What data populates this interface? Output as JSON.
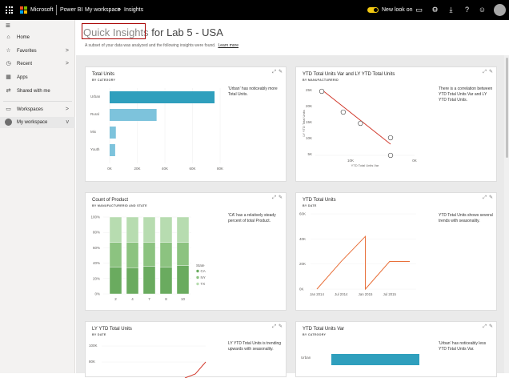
{
  "topbar": {
    "ms_label": "Microsoft",
    "app_label": "Power BI",
    "breadcrumb": [
      "My workspace",
      "Insights"
    ],
    "breadcrumb_sep": ">",
    "new_look_label": "New look on",
    "icons": [
      "comment-icon",
      "settings-icon",
      "download-icon",
      "help-icon",
      "smiley-icon"
    ]
  },
  "sidebar": {
    "items": [
      {
        "label": "Home",
        "icon": "home-icon",
        "chevron": ""
      },
      {
        "label": "Favorites",
        "icon": "star-icon",
        "chevron": ">"
      },
      {
        "label": "Recent",
        "icon": "clock-icon",
        "chevron": ">"
      },
      {
        "label": "Apps",
        "icon": "apps-icon",
        "chevron": ""
      },
      {
        "label": "Shared with me",
        "icon": "share-icon",
        "chevron": ""
      },
      {
        "label": "Workspaces",
        "icon": "workspaces-icon",
        "chevron": ">"
      },
      {
        "label": "My workspace",
        "icon": "workspace-avatar-icon",
        "chevron": "v"
      }
    ]
  },
  "header": {
    "title_highlight": "Quick Insights",
    "title_rest": "for Lab 5 - USA",
    "subtitle": "A subset of your data was analyzed and the following insights were found.",
    "learn_more": "Learn more"
  },
  "colors": {
    "bar_dark": "#2f9fbd",
    "bar_light": "#7dc3dc",
    "green_dark": "#6aab5f",
    "green_mid": "#8cc380",
    "green_light": "#b7dcb0",
    "line_orange": "#e8703a",
    "scatter_line": "#d23b2e"
  },
  "cards": [
    {
      "title": "Total Units",
      "subtitle": "BY CATEGORY",
      "description": "'Urban' has noticeably more Total Units.",
      "chart_data": {
        "type": "bar",
        "orientation": "horizontal",
        "categories": [
          "Urban",
          "Rural",
          "Mix",
          "Youth"
        ],
        "values": [
          76000,
          34000,
          4500,
          4000
        ],
        "highlight": "Urban",
        "xlim": [
          0,
          80000
        ],
        "xticks": [
          "0K",
          "20K",
          "40K",
          "60K",
          "80K"
        ]
      }
    },
    {
      "title": "YTD Total Units Var and LY YTD Total Units",
      "subtitle": "BY MANUFACTURERID",
      "description": "There is a correlation between YTD Total Units Var and LY YTD Total Units.",
      "chart_data": {
        "type": "scatter",
        "xlabel": "YTD Total Units Var",
        "ylabel": "LY YTD Total Units",
        "x": [
          -5000,
          0,
          4000,
          11000,
          11000
        ],
        "y": [
          27000,
          20500,
          17000,
          12500,
          7000
        ],
        "trendline": true,
        "yticks": [
          "25K",
          "20K",
          "15K",
          "10K",
          "5K"
        ],
        "xticks": [
          "10K",
          "0K"
        ]
      }
    },
    {
      "title": "Count of Product",
      "subtitle": "BY MANUFACTURERID AND STATE",
      "description": "'CA' has a relatively steady percent of total Product.",
      "chart_data": {
        "type": "bar",
        "stacked": true,
        "percent": true,
        "categories": [
          "2",
          "4",
          "7",
          "8",
          "10"
        ],
        "series": [
          {
            "name": "CA",
            "values": [
              35,
              34,
              36,
              35,
              37
            ]
          },
          {
            "name": "NY",
            "values": [
              32,
              33,
              31,
              32,
              30
            ]
          },
          {
            "name": "TX",
            "values": [
              33,
              33,
              33,
              33,
              33
            ]
          }
        ],
        "legend_title": "State",
        "legend": "right",
        "yticks": [
          "100%",
          "80%",
          "60%",
          "40%",
          "20%",
          "0%"
        ]
      }
    },
    {
      "title": "YTD Total Units",
      "subtitle": "BY DATE",
      "description": "YTD Total Units shows several trends with seasonality.",
      "chart_data": {
        "type": "line",
        "x": [
          "Jan 2014",
          "Jul 2014",
          "Jan 2015",
          "Jan 2015",
          "Jul 2015",
          "Dec 2015"
        ],
        "y": [
          0,
          22000,
          42000,
          0,
          22000,
          22000
        ],
        "yticks": [
          "60K",
          "40K",
          "20K",
          "0K"
        ],
        "xticks": [
          "Jan 2014",
          "Jul 2014",
          "Jan 2015",
          "Jul 2015"
        ]
      }
    },
    {
      "title": "LY YTD Total Units",
      "subtitle": "BY DATE",
      "description": "LY YTD Total Units is trending upwards with seasonality.",
      "chart_data": {
        "type": "line",
        "yticks": [
          "100K",
          "80K"
        ],
        "x": [
          0.8,
          0.9,
          1.0
        ],
        "y": [
          60000,
          65000,
          80000
        ]
      }
    },
    {
      "title": "YTD Total Units Var",
      "subtitle": "BY CATEGORY",
      "description": "'Urban' has noticeably less YTD Total Units Var.",
      "chart_data": {
        "type": "bar",
        "orientation": "horizontal",
        "categories": [
          "Urban"
        ],
        "values": [
          -14000
        ],
        "highlight": "Urban"
      }
    }
  ]
}
